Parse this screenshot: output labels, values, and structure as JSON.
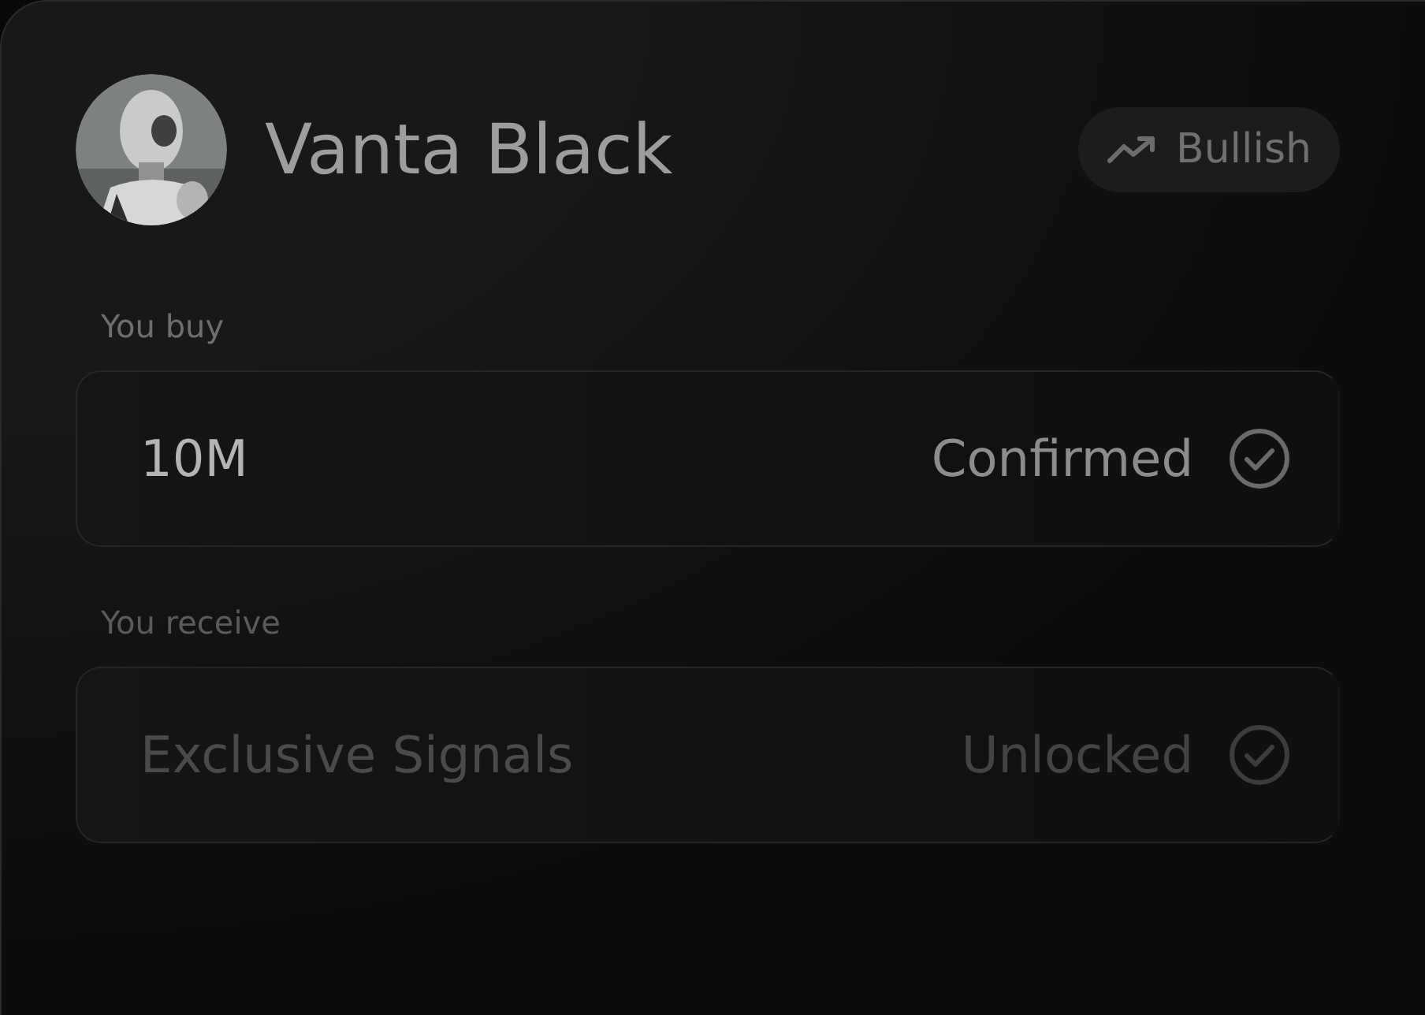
{
  "profile": {
    "name": "Vanta Black"
  },
  "badge": {
    "label": "Bullish"
  },
  "rows": [
    {
      "label": "You buy",
      "value": "10M",
      "status": "Confirmed",
      "checked": true
    },
    {
      "label": "You receive",
      "value": "Exclusive Signals",
      "status": "Unlocked",
      "checked": true
    }
  ]
}
